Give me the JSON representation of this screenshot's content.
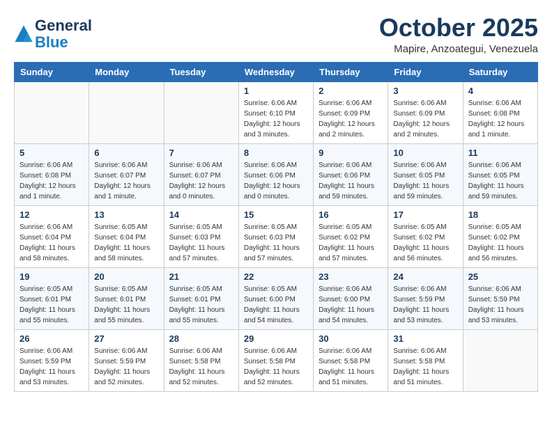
{
  "header": {
    "logo_line1": "General",
    "logo_line2": "Blue",
    "month": "October 2025",
    "subtitle": "Mapire, Anzoategui, Venezuela"
  },
  "weekdays": [
    "Sunday",
    "Monday",
    "Tuesday",
    "Wednesday",
    "Thursday",
    "Friday",
    "Saturday"
  ],
  "weeks": [
    [
      {
        "day": "",
        "info": ""
      },
      {
        "day": "",
        "info": ""
      },
      {
        "day": "",
        "info": ""
      },
      {
        "day": "1",
        "info": "Sunrise: 6:06 AM\nSunset: 6:10 PM\nDaylight: 12 hours\nand 3 minutes."
      },
      {
        "day": "2",
        "info": "Sunrise: 6:06 AM\nSunset: 6:09 PM\nDaylight: 12 hours\nand 2 minutes."
      },
      {
        "day": "3",
        "info": "Sunrise: 6:06 AM\nSunset: 6:09 PM\nDaylight: 12 hours\nand 2 minutes."
      },
      {
        "day": "4",
        "info": "Sunrise: 6:06 AM\nSunset: 6:08 PM\nDaylight: 12 hours\nand 1 minute."
      }
    ],
    [
      {
        "day": "5",
        "info": "Sunrise: 6:06 AM\nSunset: 6:08 PM\nDaylight: 12 hours\nand 1 minute."
      },
      {
        "day": "6",
        "info": "Sunrise: 6:06 AM\nSunset: 6:07 PM\nDaylight: 12 hours\nand 1 minute."
      },
      {
        "day": "7",
        "info": "Sunrise: 6:06 AM\nSunset: 6:07 PM\nDaylight: 12 hours\nand 0 minutes."
      },
      {
        "day": "8",
        "info": "Sunrise: 6:06 AM\nSunset: 6:06 PM\nDaylight: 12 hours\nand 0 minutes."
      },
      {
        "day": "9",
        "info": "Sunrise: 6:06 AM\nSunset: 6:06 PM\nDaylight: 11 hours\nand 59 minutes."
      },
      {
        "day": "10",
        "info": "Sunrise: 6:06 AM\nSunset: 6:05 PM\nDaylight: 11 hours\nand 59 minutes."
      },
      {
        "day": "11",
        "info": "Sunrise: 6:06 AM\nSunset: 6:05 PM\nDaylight: 11 hours\nand 59 minutes."
      }
    ],
    [
      {
        "day": "12",
        "info": "Sunrise: 6:06 AM\nSunset: 6:04 PM\nDaylight: 11 hours\nand 58 minutes."
      },
      {
        "day": "13",
        "info": "Sunrise: 6:05 AM\nSunset: 6:04 PM\nDaylight: 11 hours\nand 58 minutes."
      },
      {
        "day": "14",
        "info": "Sunrise: 6:05 AM\nSunset: 6:03 PM\nDaylight: 11 hours\nand 57 minutes."
      },
      {
        "day": "15",
        "info": "Sunrise: 6:05 AM\nSunset: 6:03 PM\nDaylight: 11 hours\nand 57 minutes."
      },
      {
        "day": "16",
        "info": "Sunrise: 6:05 AM\nSunset: 6:02 PM\nDaylight: 11 hours\nand 57 minutes."
      },
      {
        "day": "17",
        "info": "Sunrise: 6:05 AM\nSunset: 6:02 PM\nDaylight: 11 hours\nand 56 minutes."
      },
      {
        "day": "18",
        "info": "Sunrise: 6:05 AM\nSunset: 6:02 PM\nDaylight: 11 hours\nand 56 minutes."
      }
    ],
    [
      {
        "day": "19",
        "info": "Sunrise: 6:05 AM\nSunset: 6:01 PM\nDaylight: 11 hours\nand 55 minutes."
      },
      {
        "day": "20",
        "info": "Sunrise: 6:05 AM\nSunset: 6:01 PM\nDaylight: 11 hours\nand 55 minutes."
      },
      {
        "day": "21",
        "info": "Sunrise: 6:05 AM\nSunset: 6:01 PM\nDaylight: 11 hours\nand 55 minutes."
      },
      {
        "day": "22",
        "info": "Sunrise: 6:05 AM\nSunset: 6:00 PM\nDaylight: 11 hours\nand 54 minutes."
      },
      {
        "day": "23",
        "info": "Sunrise: 6:06 AM\nSunset: 6:00 PM\nDaylight: 11 hours\nand 54 minutes."
      },
      {
        "day": "24",
        "info": "Sunrise: 6:06 AM\nSunset: 5:59 PM\nDaylight: 11 hours\nand 53 minutes."
      },
      {
        "day": "25",
        "info": "Sunrise: 6:06 AM\nSunset: 5:59 PM\nDaylight: 11 hours\nand 53 minutes."
      }
    ],
    [
      {
        "day": "26",
        "info": "Sunrise: 6:06 AM\nSunset: 5:59 PM\nDaylight: 11 hours\nand 53 minutes."
      },
      {
        "day": "27",
        "info": "Sunrise: 6:06 AM\nSunset: 5:59 PM\nDaylight: 11 hours\nand 52 minutes."
      },
      {
        "day": "28",
        "info": "Sunrise: 6:06 AM\nSunset: 5:58 PM\nDaylight: 11 hours\nand 52 minutes."
      },
      {
        "day": "29",
        "info": "Sunrise: 6:06 AM\nSunset: 5:58 PM\nDaylight: 11 hours\nand 52 minutes."
      },
      {
        "day": "30",
        "info": "Sunrise: 6:06 AM\nSunset: 5:58 PM\nDaylight: 11 hours\nand 51 minutes."
      },
      {
        "day": "31",
        "info": "Sunrise: 6:06 AM\nSunset: 5:58 PM\nDaylight: 11 hours\nand 51 minutes."
      },
      {
        "day": "",
        "info": ""
      }
    ]
  ]
}
